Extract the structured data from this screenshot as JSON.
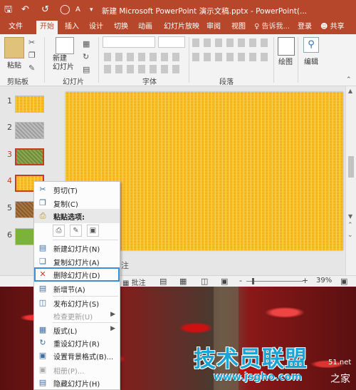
{
  "title_bar": {
    "title": "新建 Microsoft PowerPoint 演示文稿.pptx - PowerPoint(...",
    "icons": [
      "save-icon",
      "undo-icon",
      "redo-icon",
      "start-from-beginning-icon",
      "font-size-icon",
      "customize-quick-access-icon"
    ]
  },
  "ribbon": {
    "tabs": [
      "文件",
      "开始",
      "插入",
      "设计",
      "切换",
      "动画",
      "幻灯片放映",
      "审阅",
      "视图",
      "♀ 告诉我...",
      "登录",
      "共享"
    ],
    "active_tab": "开始",
    "groups": {
      "clipboard": {
        "label": "剪贴板",
        "paste": "粘贴"
      },
      "slides": {
        "label": "幻灯片",
        "new_slide": "新建\n幻灯片"
      },
      "font": {
        "label": "字体"
      },
      "paragraph": {
        "label": "段落"
      },
      "drawing": {
        "label": "绘图"
      },
      "editing": {
        "label": "编辑"
      }
    }
  },
  "slides_panel": {
    "numbers": [
      "1",
      "2",
      "3",
      "4",
      "5",
      "6"
    ],
    "selected": [
      "3",
      "4"
    ]
  },
  "notes_hint": "注",
  "status_bar": {
    "notes": "批注",
    "zoom_minus": "-",
    "zoom_plus": "+",
    "zoom": "39%"
  },
  "context_menu": {
    "items": [
      {
        "label": "剪切(T)",
        "icon": "scissors-icon"
      },
      {
        "label": "复制(C)",
        "icon": "copy-icon"
      },
      {
        "label": "粘贴选项:",
        "icon": "paste-icon",
        "header": true
      },
      {
        "label": "新建幻灯片(N)",
        "icon": "new-slide-icon"
      },
      {
        "label": "复制幻灯片(A)",
        "icon": "duplicate-slide-icon"
      },
      {
        "label": "删除幻灯片(D)",
        "icon": "delete-slide-icon",
        "highlight": true
      },
      {
        "label": "新增节(A)",
        "icon": "add-section-icon"
      },
      {
        "label": "发布幻灯片(S)",
        "icon": "publish-slides-icon"
      },
      {
        "label": "检查更新(U)",
        "icon": "",
        "disabled": true,
        "submenu": true
      },
      {
        "label": "版式(L)",
        "icon": "layout-icon",
        "submenu": true
      },
      {
        "label": "重设幻灯片(R)",
        "icon": "reset-slide-icon"
      },
      {
        "label": "设置背景格式(B)...",
        "icon": "format-background-icon"
      },
      {
        "label": "相册(P)...",
        "icon": "photo-album-icon",
        "disabled": true
      },
      {
        "label": "隐藏幻灯片(H)",
        "icon": "hide-slide-icon"
      }
    ]
  },
  "watermark": {
    "main": "技术员联盟",
    "url": "www.jsgho.com",
    "home": "之家",
    "fragment": "51.net"
  },
  "colors": {
    "accent": "#b7472a",
    "slide_fill": "#f7c22e",
    "selection": "#c43e1c",
    "highlight_box": "#3c8fd6",
    "watermark": "#19a5d6"
  }
}
